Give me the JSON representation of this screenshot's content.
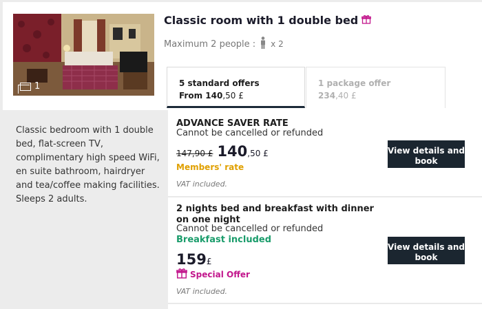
{
  "room": {
    "title": "Classic room with 1 double bed",
    "occupancy_label": "Maximum 2 people :",
    "occupancy_count": "x 2",
    "photo_count": "1",
    "description": "Classic bedroom with 1 double bed, flat-screen TV, complimentary high speed WiFi, en suite bathroom, hairdryer and tea/coffee making facilities. Sleeps 2 adults."
  },
  "tabs": [
    {
      "label": "5 standard offers",
      "price_prefix": "From 140",
      "price_cents": ",50 £"
    },
    {
      "label": "1 package offer",
      "price_prefix": "234",
      "price_cents": ",40 £"
    }
  ],
  "offers": [
    {
      "name": "ADVANCE SAVER RATE",
      "cancellation": "Cannot be cancelled or refunded",
      "old_price": "147,90 £",
      "price": "140",
      "price_cents": ",50 £",
      "tag": "Members' rate",
      "vat": "VAT included.",
      "button": "View details and book"
    },
    {
      "name": "2 nights bed and breakfast with dinner on one night",
      "cancellation": "Cannot be cancelled or refunded",
      "meal": "Breakfast included",
      "price": "159",
      "price_cents": "£",
      "tag": "Special Offer",
      "vat": "VAT included.",
      "button": "View details and book"
    }
  ],
  "colors": {
    "accent_dark": "#1b2630",
    "members_rate": "#e0a000",
    "breakfast": "#1a9c6b",
    "special_offer": "#c2168c"
  },
  "icons": [
    "gift-icon",
    "person-icon",
    "gallery-icon"
  ]
}
